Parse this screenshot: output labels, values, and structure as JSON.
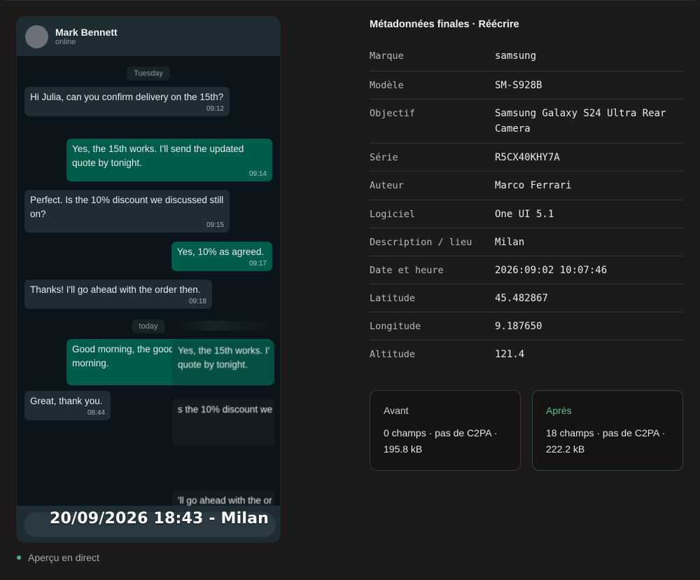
{
  "chat": {
    "contact_name": "Mark Bennett",
    "contact_status": "online",
    "day_labels": [
      "Tuesday",
      "today"
    ],
    "messages": [
      {
        "dir": "in",
        "text": "Hi Julia, can you confirm delivery on the 15th?",
        "time": "09:12"
      },
      {
        "dir": "out",
        "text": "Yes, the 15th works. I'll send the updated quote by tonight.",
        "time": "09:14"
      },
      {
        "dir": "in",
        "text": "Perfect. Is the 10% discount we discussed still on?",
        "time": "09:15"
      },
      {
        "dir": "out",
        "text": "Yes, 10% as agreed.",
        "time": "09:17"
      },
      {
        "dir": "in",
        "text": "Thanks! I'll go ahead with the order then.",
        "time": "09:18"
      },
      {
        "dir": "out",
        "text": "Good morning, the goods",
        "text2": "morning.",
        "time": ""
      },
      {
        "dir": "in",
        "text": "Great, thank you.",
        "time": "08:44"
      }
    ],
    "ghost_fragments": [
      "Yes, the 15th works. I'",
      "quote by tonight.",
      "s the 10% discount we",
      "'ll go ahead with the or"
    ]
  },
  "overlay": {
    "stamp": "20/09/2026 18:43 - Milan"
  },
  "live_label": "Aperçu en direct",
  "panel": {
    "title": "Métadonnées finales · Réécrire",
    "rows": [
      {
        "key": "Marque",
        "value": "samsung"
      },
      {
        "key": "Modèle",
        "value": "SM-S928B"
      },
      {
        "key": "Objectif",
        "value": "Samsung Galaxy S24 Ultra Rear Camera"
      },
      {
        "key": "Série",
        "value": "R5CX40KHY7A"
      },
      {
        "key": "Auteur",
        "value": "Marco Ferrari"
      },
      {
        "key": "Logiciel",
        "value": "One UI 5.1"
      },
      {
        "key": "Description / lieu",
        "value": "Milan"
      },
      {
        "key": "Date et heure",
        "value": "2026:09:02 10:07:46"
      },
      {
        "key": "Latitude",
        "value": "45.482867"
      },
      {
        "key": "Longitude",
        "value": "9.187650"
      },
      {
        "key": "Altitude",
        "value": "121.4"
      }
    ],
    "before": {
      "title": "Avant",
      "body": "0 champs · pas de C2PA · 195.8 kB"
    },
    "after": {
      "title": "Après",
      "body": "18 champs · pas de C2PA · 222.2 kB"
    }
  },
  "colors": {
    "accent": "#5fbf8e",
    "bubble_out": "#005c4b",
    "bubble_in": "#202c33"
  }
}
